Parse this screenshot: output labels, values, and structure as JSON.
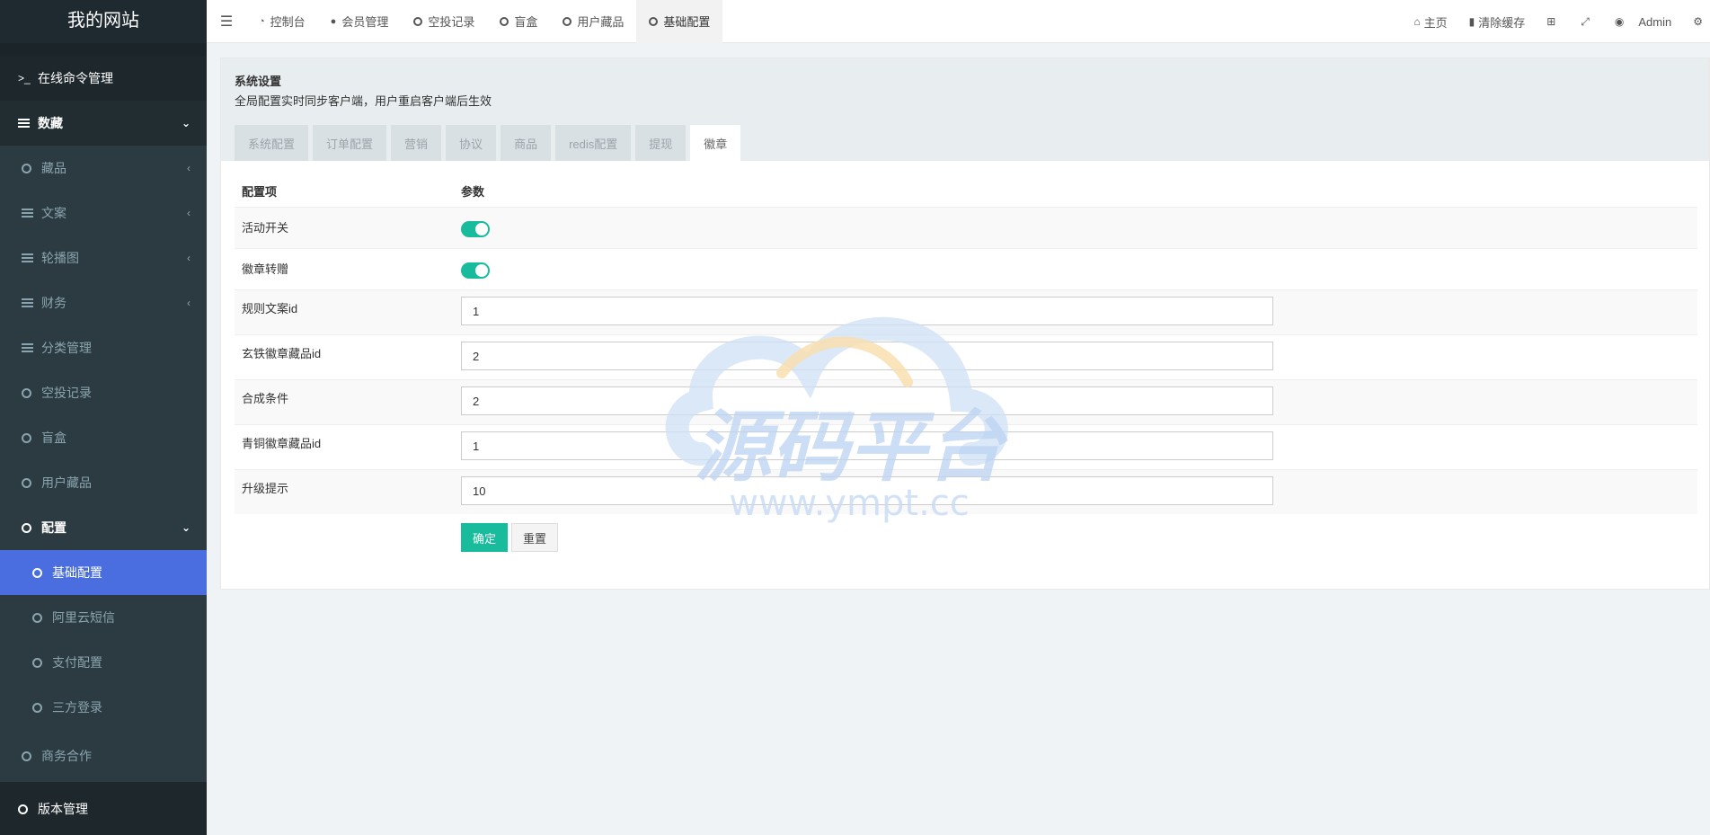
{
  "sidebar": {
    "brand": "我的网站",
    "items": [
      {
        "label": "在线命令管理"
      },
      {
        "label": "数藏"
      },
      {
        "label": "藏品"
      },
      {
        "label": "文案"
      },
      {
        "label": "轮播图"
      },
      {
        "label": "财务"
      },
      {
        "label": "分类管理"
      },
      {
        "label": "空投记录"
      },
      {
        "label": "盲盒"
      },
      {
        "label": "用户藏品"
      },
      {
        "label": "配置"
      },
      {
        "label": "基础配置"
      },
      {
        "label": "阿里云短信"
      },
      {
        "label": "支付配置"
      },
      {
        "label": "三方登录"
      },
      {
        "label": "商务合作"
      },
      {
        "label": "版本管理"
      }
    ]
  },
  "topbar": {
    "tabs": [
      {
        "label": "控制台",
        "icon": "dashboard-icon"
      },
      {
        "label": "会员管理",
        "icon": "user-icon"
      },
      {
        "label": "空投记录",
        "icon": "circle-icon"
      },
      {
        "label": "盲盒",
        "icon": "circle-icon"
      },
      {
        "label": "用户藏品",
        "icon": "circle-icon"
      },
      {
        "label": "基础配置",
        "icon": "circle-icon"
      }
    ],
    "right": {
      "home": "主页",
      "clear_cache": "清除缓存",
      "user": "Admin"
    }
  },
  "panel": {
    "title": "系统设置",
    "description": "全局配置实时同步客户端，用户重启客户端后生效",
    "tabs": [
      "系统配置",
      "订单配置",
      "营销",
      "协议",
      "商品",
      "redis配置",
      "提现",
      "徽章"
    ],
    "active_tab": "徽章",
    "table": {
      "col_key": "配置项",
      "col_value": "参数",
      "rows": [
        {
          "label": "活动开关",
          "type": "toggle",
          "on": true
        },
        {
          "label": "徽章转赠",
          "type": "toggle",
          "on": true
        },
        {
          "label": "规则文案id",
          "value": "1"
        },
        {
          "label": "玄铁徽章藏品id",
          "value": "2"
        },
        {
          "label": "合成条件",
          "value": "2"
        },
        {
          "label": "青铜徽章藏品id",
          "value": "1"
        },
        {
          "label": "升级提示",
          "value": "10"
        }
      ]
    },
    "buttons": {
      "confirm": "确定",
      "reset": "重置"
    }
  },
  "watermark": {
    "text": "源码平台",
    "url": "www.ympt.cc"
  },
  "colors": {
    "sidebar": "#222d32",
    "active": "#4a6ee0",
    "accent": "#18bc9c"
  }
}
